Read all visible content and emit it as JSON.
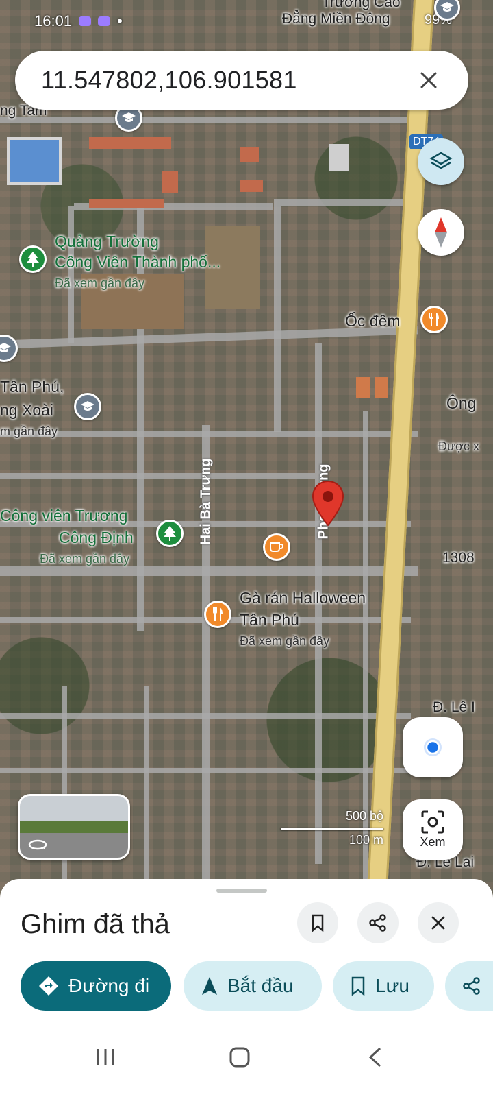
{
  "status_bar": {
    "time": "16:01",
    "battery": "99%"
  },
  "search": {
    "query": "11.547802,106.901581"
  },
  "map_labels": {
    "top_school": "Đẳng Miền Đông",
    "top_partial": "Trường Cao",
    "tam": "ng Tam",
    "dt_badge": "DT74",
    "square_line1": "Quảng Trường",
    "square_line2": "Công Viên Thành phố...",
    "square_sub": "Đã xem gần đây",
    "oc_dem": "Ốc đêm",
    "tan_phu_line1": "Tân Phú,",
    "tan_phu_line2": "ng Xoài",
    "tan_phu_sub": "m gần đây",
    "ong": "Ông",
    "duoc": "Được x",
    "park_line1": "Công viên Trương",
    "park_line2": "Công Định",
    "park_sub": "Đã xem gần đây",
    "hai_ba_trung": "Hai Bà Trưng",
    "phan": "Phan Trung",
    "road_1308": "1308",
    "ga_ran_line1": "Gà rán Halloween",
    "ga_ran_line2": "Tân Phú",
    "ga_ran_sub": "Đã xem gần đây",
    "le_1": "Đ. Lê I",
    "le_lai": "Đ. Lê Lai"
  },
  "scale": {
    "imperial": "500 bộ",
    "metric": "100 m"
  },
  "lens": {
    "label": "Xem"
  },
  "sheet": {
    "title": "Ghim đã thả",
    "chips": [
      {
        "label": "Đường đi",
        "icon": "directions-icon"
      },
      {
        "label": "Bắt đầu",
        "icon": "navigation-arrow-icon"
      },
      {
        "label": "Lưu",
        "icon": "bookmark-icon"
      }
    ]
  },
  "colors": {
    "primary_chip": "#0b6b7a",
    "secondary_chip": "#d6eef3",
    "pin": "#e0372b"
  }
}
